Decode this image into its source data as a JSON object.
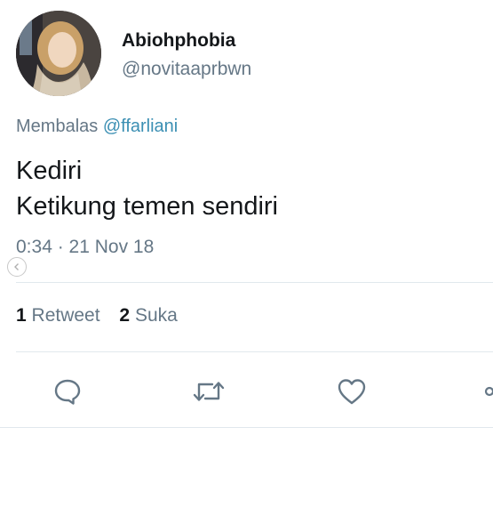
{
  "profile": {
    "display_name": "Abiohphobia",
    "username": "@novitaaprbwn"
  },
  "reply": {
    "prefix": "Membalas",
    "mention": "@ffarliani"
  },
  "tweet": {
    "lines": [
      "Kediri",
      "Ketikung temen sendiri"
    ],
    "timestamp": "0:34 · 21 Nov 18"
  },
  "stats": {
    "retweets": {
      "count": "1",
      "label": "Retweet"
    },
    "likes": {
      "count": "2",
      "label": "Suka"
    }
  },
  "actions": {
    "icons": [
      "reply-icon",
      "retweet-icon",
      "like-icon",
      "share-icon"
    ]
  },
  "colors": {
    "text": "#14171a",
    "secondary": "#657786",
    "mention": "#3b8fb3",
    "divider": "#e1e8ed",
    "icon": "#657786"
  }
}
